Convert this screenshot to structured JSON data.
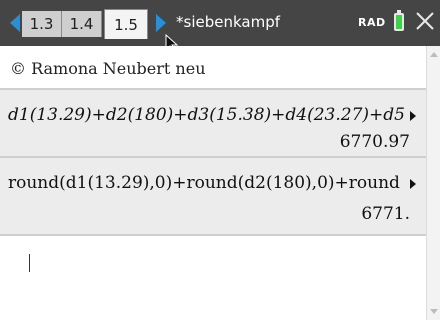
{
  "tabs": [
    {
      "label": "1.3"
    },
    {
      "label": "1.4"
    },
    {
      "label": "1.5",
      "active": true
    }
  ],
  "header": {
    "document_title": "*siebenkampf",
    "angle_mode": "RAD",
    "accent_color": "#2a8fd6",
    "battery_color": "#3fd14a"
  },
  "calculator": {
    "comment": "© Ramona Neubert neu",
    "entries": [
      {
        "expression": "d1(13.29)+d2(180)+d3(15.38)+d4(23.27)+d5",
        "result": "6770.97"
      },
      {
        "expression": "round(d1(13.29),0)+round(d2(180),0)+round",
        "result": "6771."
      }
    ]
  },
  "icons": {
    "left": "scroll-tabs-left-icon",
    "right": "scroll-tabs-right-icon",
    "close": "close-icon",
    "battery": "battery-icon"
  }
}
